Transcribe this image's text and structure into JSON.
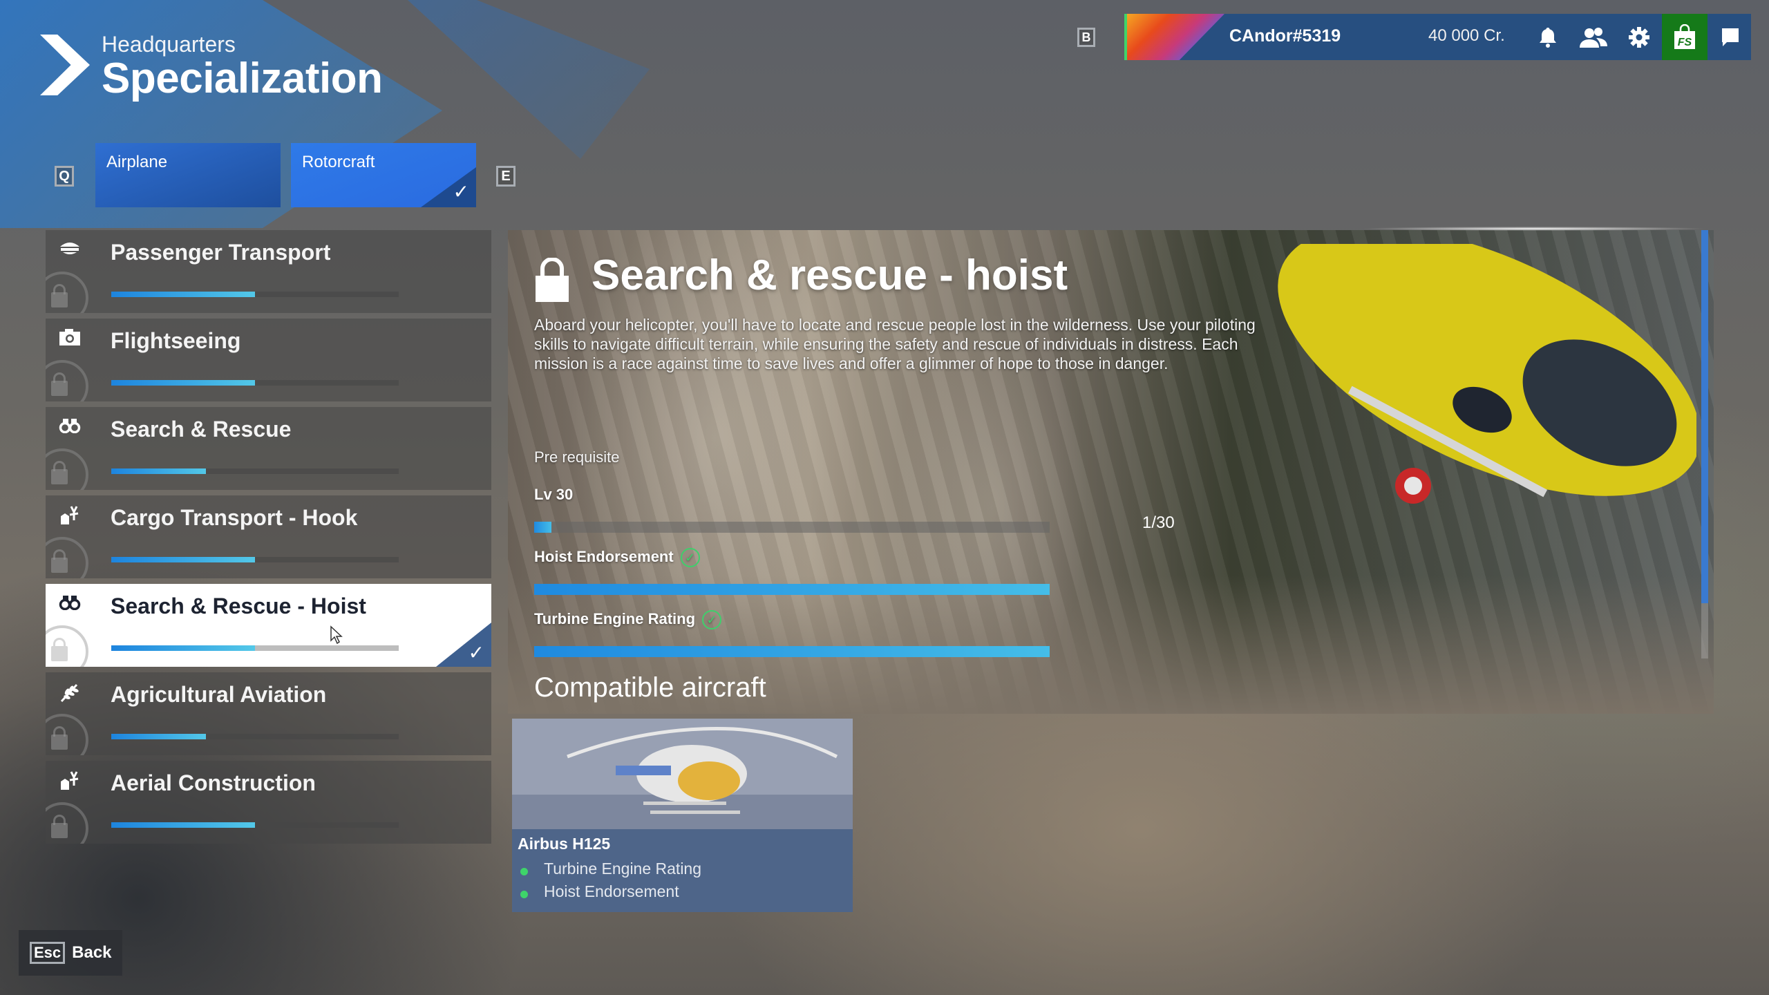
{
  "header": {
    "breadcrumb": "Headquarters",
    "title": "Specialization"
  },
  "keys": {
    "prev": "Q",
    "next": "E",
    "profile": "B",
    "back": "Esc"
  },
  "categories": [
    {
      "label": "Airplane",
      "selected": false
    },
    {
      "label": "Rotorcraft",
      "selected": true
    }
  ],
  "topbar": {
    "username": "CAndor#5319",
    "credits": "40 000 Cr.",
    "icons": [
      "bell-icon",
      "friends-icon",
      "settings-icon",
      "store-icon",
      "chat-icon"
    ],
    "store_label": "FS",
    "store_color": "#157a19",
    "bar_color": "#274f80"
  },
  "specializations": [
    {
      "name": "Passenger Transport",
      "icon": "pilot-cap-icon",
      "progress": 0.5,
      "locked": true,
      "selected": false
    },
    {
      "name": "Flightseeing",
      "icon": "camera-icon",
      "progress": 0.5,
      "locked": true,
      "selected": false
    },
    {
      "name": "Search & Rescue",
      "icon": "binoculars-icon",
      "progress": 0.33,
      "locked": true,
      "selected": false
    },
    {
      "name": "Cargo Transport - Hook",
      "icon": "cargo-hook-icon",
      "progress": 0.5,
      "locked": true,
      "selected": false
    },
    {
      "name": "Search & Rescue - Hoist",
      "icon": "binoculars-icon",
      "progress": 0.5,
      "locked": true,
      "selected": true
    },
    {
      "name": "Agricultural Aviation",
      "icon": "wheat-icon",
      "progress": 0.33,
      "locked": true,
      "selected": false
    },
    {
      "name": "Aerial Construction",
      "icon": "cargo-hook-icon",
      "progress": 0.5,
      "locked": true,
      "selected": false
    }
  ],
  "detail": {
    "title": "Search & rescue - hoist",
    "description": "Aboard your helicopter, you'll have to locate and rescue people lost in the wilderness. Use your piloting skills to navigate difficult terrain, while ensuring the safety and rescue of individuals in distress. Each mission is a race against time to save lives and offer a glimmer of hope to those in danger.",
    "prereq_label": "Pre requisite",
    "requirements": [
      {
        "label": "Lv 30",
        "progress": 0.033,
        "count": "1/30",
        "complete": false
      },
      {
        "label": "Hoist Endorsement",
        "progress": 1.0,
        "complete": true
      },
      {
        "label": "Turbine Engine Rating",
        "progress": 1.0,
        "complete": true
      }
    ],
    "compatible_title": "Compatible aircraft",
    "aircraft": [
      {
        "name": "Airbus H125",
        "requirements": [
          "Turbine Engine Rating",
          "Hoist Endorsement"
        ]
      }
    ]
  },
  "footer": {
    "back_label": "Back"
  },
  "colors": {
    "accent": "#2f7ae8",
    "progress_start": "#1d84de",
    "progress_end": "#53c8e8",
    "check_green": "#3fcf6c"
  }
}
